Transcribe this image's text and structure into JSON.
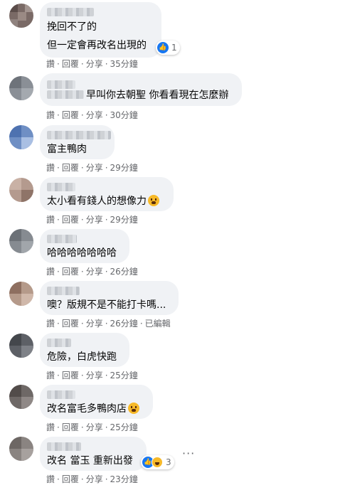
{
  "actions": {
    "like": "讚",
    "reply": "回覆",
    "share": "分享",
    "dot": "·"
  },
  "comments": [
    {
      "lines": [
        "挽回不了的",
        "但一定會再改名出現的"
      ],
      "time": "35分鐘",
      "reaction_count": "1",
      "reactions": [
        "like-icon"
      ]
    },
    {
      "lines": [
        "早叫你去朝聖 你看看現在怎麼辦"
      ],
      "time": "30分鐘"
    },
    {
      "lines": [
        "富主鴨肉"
      ],
      "time": "29分鐘"
    },
    {
      "lines": [
        "太小看有錢人的想像力"
      ],
      "time": "29分鐘",
      "emoji": "crying-laughing-emoji"
    },
    {
      "lines": [
        "哈哈哈哈哈哈哈"
      ],
      "time": "26分鐘"
    },
    {
      "lines": [
        "噢？版規不是不能打卡嗎..."
      ],
      "time": "26分鐘",
      "edited": "已編輯"
    },
    {
      "lines": [
        "危險，白虎快跑"
      ],
      "time": "25分鐘"
    },
    {
      "lines": [
        "改名富毛多鴨肉店"
      ],
      "time": "25分鐘",
      "emoji": "grinning-emoji"
    },
    {
      "lines": [
        "改名 當玉 重新出發"
      ],
      "time": "23分鐘",
      "reaction_count": "3",
      "reactions": [
        "like-icon",
        "haha-icon"
      ],
      "more": "···"
    }
  ]
}
